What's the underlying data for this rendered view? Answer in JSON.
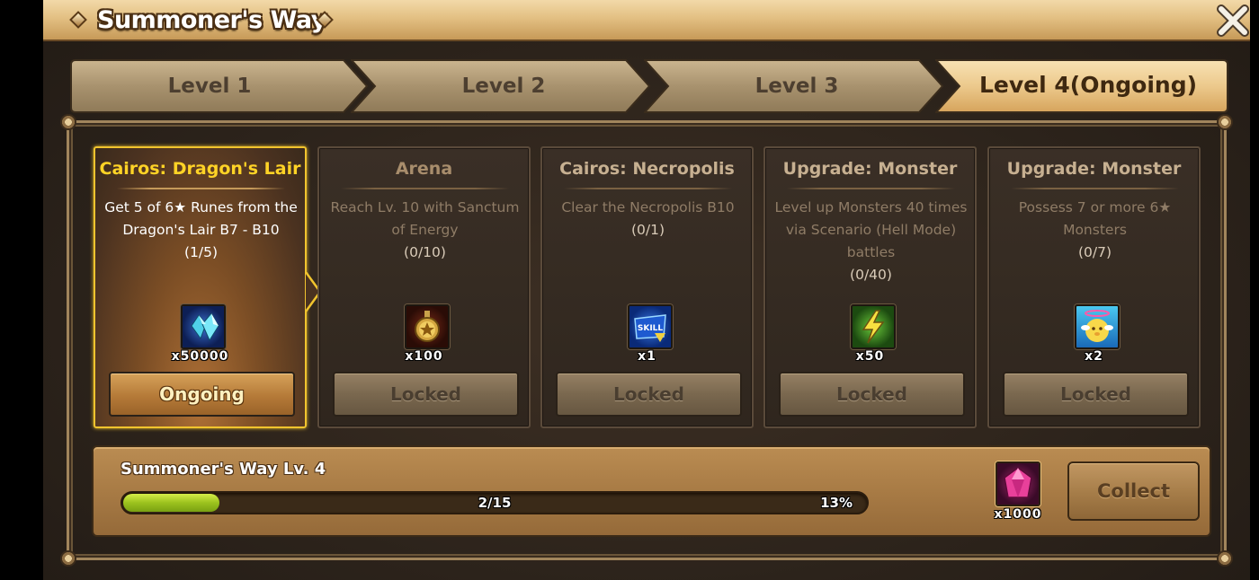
{
  "window": {
    "title": "Summoner's Way",
    "close_icon": "close-icon"
  },
  "tabs": [
    {
      "label": "Level 1",
      "active": false
    },
    {
      "label": "Level 2",
      "active": false
    },
    {
      "label": "Level 3",
      "active": false
    },
    {
      "label": "Level 4(Ongoing)",
      "active": true
    }
  ],
  "missions": [
    {
      "title": "Cairos: Dragon's Lair",
      "description": "Get 5 of 6★ Runes from the Dragon's Lair B7 - B10",
      "progress": "(1/5)",
      "reward_icon": "crystal-icon",
      "reward_qty": "x50000",
      "button_label": "Ongoing",
      "active": true
    },
    {
      "title": "Arena",
      "description": "Reach Lv. 10 with Sanctum of Energy",
      "progress": "(0/10)",
      "reward_icon": "glory-medal-icon",
      "reward_qty": "x100",
      "button_label": "Locked",
      "active": false
    },
    {
      "title": "Cairos: Necropolis",
      "description": "Clear the Necropolis B10",
      "progress": "(0/1)",
      "reward_icon": "skill-scroll-icon",
      "reward_qty": "x1",
      "button_label": "Locked",
      "active": false
    },
    {
      "title": "Upgrade: Monster",
      "description": "Level up Monsters 40 times via Scenario (Hell Mode) battles",
      "progress": "(0/40)",
      "reward_icon": "energy-bolt-icon",
      "reward_qty": "x50",
      "button_label": "Locked",
      "active": false
    },
    {
      "title": "Upgrade: Monster",
      "description": "Possess 7 or more 6★ Monsters",
      "progress": "(0/7)",
      "reward_icon": "angelmon-icon",
      "reward_qty": "x2",
      "button_label": "Locked",
      "active": false
    }
  ],
  "level_progress": {
    "title": "Summoner's Way Lv. 4",
    "count": "2/15",
    "percent_label": "13%",
    "fill_fraction": 0.13,
    "reward_icon": "pink-crystal-icon",
    "reward_qty": "x1000",
    "collect_label": "Collect"
  },
  "colors": {
    "active_title": "#ffd326",
    "active_border": "#f1c42e",
    "progress_green": "#9bc21e"
  }
}
